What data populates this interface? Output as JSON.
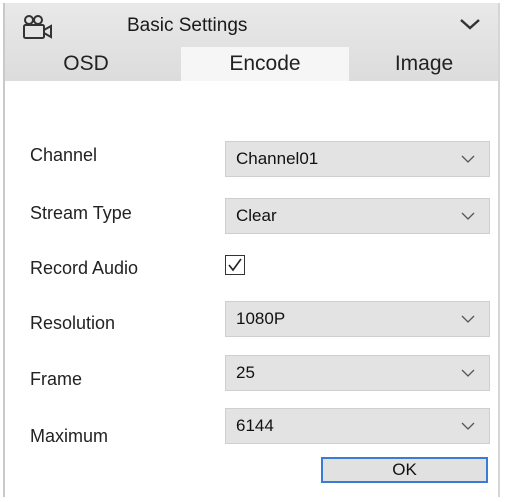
{
  "header": {
    "title": "Basic Settings",
    "icon": "camera-settings-icon",
    "collapse_icon": "chevron-down-icon"
  },
  "tabs": [
    {
      "label": "OSD",
      "active": false
    },
    {
      "label": "Encode",
      "active": true
    },
    {
      "label": "Image",
      "active": false
    }
  ],
  "form": {
    "channel": {
      "label": "Channel",
      "value": "Channel01"
    },
    "stream_type": {
      "label": "Stream Type",
      "value": "Clear"
    },
    "record_audio": {
      "label": "Record Audio",
      "checked": true
    },
    "resolution": {
      "label": "Resolution",
      "value": "1080P"
    },
    "frame": {
      "label": "Frame",
      "value": "25"
    },
    "maximum": {
      "label": "Maximum",
      "value": "6144"
    },
    "ok_label": "OK"
  },
  "colors": {
    "header_bg": "#e2e2e2",
    "select_bg": "#e3e3e3",
    "ok_border": "#3a7bd5"
  }
}
